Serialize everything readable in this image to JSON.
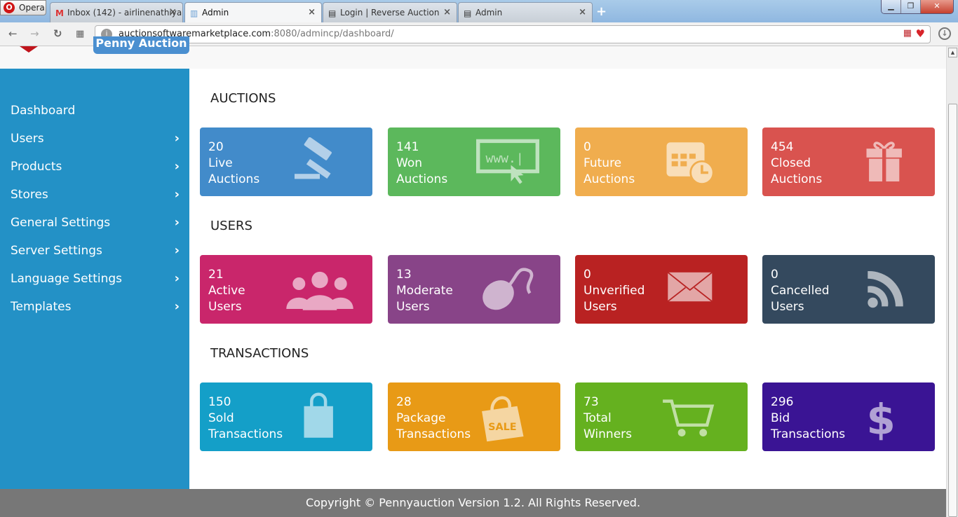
{
  "browser": {
    "opera_label": "Opera",
    "tabs": [
      {
        "title": "Inbox (142) - airlinenathiya",
        "icon": "gmail-icon"
      },
      {
        "title": "Admin",
        "icon": "page-icon"
      },
      {
        "title": "Login | Reverse Auction",
        "icon": "document-icon"
      },
      {
        "title": "Admin",
        "icon": "document-icon"
      }
    ],
    "url_host": "auctionsoftwaremarketplace.com",
    "url_path": ":8080/admincp/dashboard/"
  },
  "header": {
    "logo_text": "Penny Auction"
  },
  "sidebar": {
    "items": [
      {
        "label": "Dashboard",
        "has_children": false
      },
      {
        "label": "Users",
        "has_children": true
      },
      {
        "label": "Products",
        "has_children": true
      },
      {
        "label": "Stores",
        "has_children": true
      },
      {
        "label": "General Settings",
        "has_children": true
      },
      {
        "label": "Server Settings",
        "has_children": true
      },
      {
        "label": "Language Settings",
        "has_children": true
      },
      {
        "label": "Templates",
        "has_children": true
      }
    ]
  },
  "sections": [
    {
      "title": "AUCTIONS",
      "cards": [
        {
          "count": "20",
          "line1": "Live",
          "line2": "Auctions",
          "color": "#428bca",
          "icon": "gavel-icon"
        },
        {
          "count": "141",
          "line1": "Won",
          "line2": "Auctions",
          "color": "#5cb85c",
          "icon": "www-cursor-icon"
        },
        {
          "count": "0",
          "line1": "Future",
          "line2": "Auctions",
          "color": "#f0ad4e",
          "icon": "calendar-clock-icon"
        },
        {
          "count": "454",
          "line1": "Closed",
          "line2": "Auctions",
          "color": "#d9534f",
          "icon": "gift-icon"
        }
      ]
    },
    {
      "title": "USERS",
      "cards": [
        {
          "count": "21",
          "line1": "Active",
          "line2": "Users",
          "color": "#c9266b",
          "icon": "users-group-icon"
        },
        {
          "count": "13",
          "line1": "Moderate",
          "line2": "Users",
          "color": "#884488",
          "icon": "mouse-icon"
        },
        {
          "count": "0",
          "line1": "Unverified",
          "line2": "Users",
          "color": "#b92222",
          "icon": "envelope-icon"
        },
        {
          "count": "0",
          "line1": "Cancelled",
          "line2": "Users",
          "color": "#34495e",
          "icon": "rss-icon"
        }
      ]
    },
    {
      "title": "TRANSACTIONS",
      "cards": [
        {
          "count": "150",
          "line1": "Sold",
          "line2": "Transactions",
          "color": "#149fc8",
          "icon": "shopping-bag-icon"
        },
        {
          "count": "28",
          "line1": "Package",
          "line2": "Transactions",
          "color": "#e89a16",
          "icon": "sale-bag-icon",
          "icon_text": "SALE"
        },
        {
          "count": "73",
          "line1": "Total",
          "line2": "Winners",
          "color": "#65b11f",
          "icon": "cart-icon"
        },
        {
          "count": "296",
          "line1": "Bid",
          "line2": "Transactions",
          "color": "#3a1494",
          "icon": "dollar-icon",
          "icon_text": "$"
        }
      ]
    }
  ],
  "footer": {
    "copyright": "Copyright © Pennyauction Version 1.2. All Rights Reserved."
  }
}
